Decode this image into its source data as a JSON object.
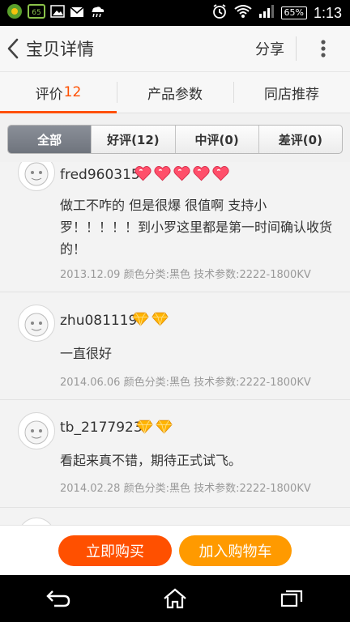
{
  "status_bar": {
    "time": "1:13",
    "battery": "65%",
    "notification_badge": "65"
  },
  "header": {
    "title": "宝贝详情",
    "share_label": "分享"
  },
  "tabs": [
    {
      "label": "评价",
      "count": "12"
    },
    {
      "label": "产品参数",
      "count": ""
    },
    {
      "label": "同店推荐",
      "count": ""
    }
  ],
  "filters": [
    {
      "label": "全部"
    },
    {
      "label": "好评(12)"
    },
    {
      "label": "中评(0)"
    },
    {
      "label": "差评(0)"
    }
  ],
  "reviews": [
    {
      "username": "fred960315",
      "badge": "heart",
      "badge_count": 5,
      "content": "做工不咋的 但是很爆 很值啊 支持小罗！！！！！到小罗这里都是第一时间确认收货的！",
      "meta": "2013.12.09 颜色分类:黑色  技术参数:2222-1800KV"
    },
    {
      "username": "zhu081119",
      "badge": "diamond",
      "badge_count": 2,
      "content": "一直很好",
      "meta": "2014.06.06 颜色分类:黑色  技术参数:2222-1800KV"
    },
    {
      "username": "tb_2177923",
      "badge": "diamond",
      "badge_count": 2,
      "content": "看起来真不错，期待正式试飞。",
      "meta": "2014.02.28 颜色分类:黑色  技术参数:2222-1800KV"
    }
  ],
  "actions": {
    "buy_now": "立即购买",
    "add_to_cart": "加入购物车"
  },
  "colors": {
    "accent": "#ff5000",
    "cart": "#ff9a00",
    "heart": "#ff4f6a",
    "diamond": "#ffb400"
  }
}
